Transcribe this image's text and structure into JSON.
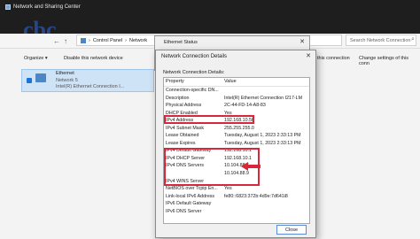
{
  "window": {
    "title": "Network and Sharing Center"
  },
  "breadcrumb": {
    "items": [
      "Control Panel",
      "Network"
    ]
  },
  "search": {
    "placeholder": "Search Network Connection"
  },
  "toolbar": {
    "organize": "Organize",
    "disable": "Disable this network device",
    "connection": "this connection",
    "change_settings": "Change settings of this conn"
  },
  "adapter": {
    "name": "Ethernet",
    "network": "Network 5",
    "device": "Intel(R) Ethernet Connection I..."
  },
  "status_dialog": {
    "title": "Ethernet Status"
  },
  "details_dialog": {
    "title": "Network Connection Details",
    "section_label": "Network Connection Details:",
    "columns": [
      "Property",
      "Value"
    ],
    "rows": [
      {
        "p": "Connection-specific DN...",
        "v": ""
      },
      {
        "p": "Description",
        "v": "Intel(R) Ethernet Connection I217-LM"
      },
      {
        "p": "Physical Address",
        "v": "2C-44-FD-14-A8-83"
      },
      {
        "p": "DHCP Enabled",
        "v": "Yes"
      },
      {
        "p": "IPv4 Address",
        "v": "192.168.10.50"
      },
      {
        "p": "IPv4 Subnet Mask",
        "v": "255.255.255.0"
      },
      {
        "p": "Lease Obtained",
        "v": "Tuesday, August 1, 2023 2:33:13 PM"
      },
      {
        "p": "Lease Expires",
        "v": "Tuesday, August 1, 2023 2:33:13 PM"
      },
      {
        "p": "IPv4 Default Gateway",
        "v": "192.168.10.1"
      },
      {
        "p": "IPv4 DHCP Server",
        "v": "192.168.10.1"
      },
      {
        "p": "IPv4 DNS Servers",
        "v": "10.104.88.6"
      },
      {
        "p": "",
        "v": "10.104.88.9"
      },
      {
        "p": "IPv4 WINS Server",
        "v": ""
      },
      {
        "p": "NetBIOS over Tcpip En...",
        "v": "Yes"
      },
      {
        "p": "Link-local IPv6 Address",
        "v": "fe80::6823:372b:4d9e:7d641i8"
      },
      {
        "p": "IPv6 Default Gateway",
        "v": ""
      },
      {
        "p": "IPv6 DNS Server",
        "v": ""
      }
    ],
    "close_label": "Close"
  },
  "colors": {
    "highlight": "#d9263a",
    "accent": "#1a73d9"
  }
}
